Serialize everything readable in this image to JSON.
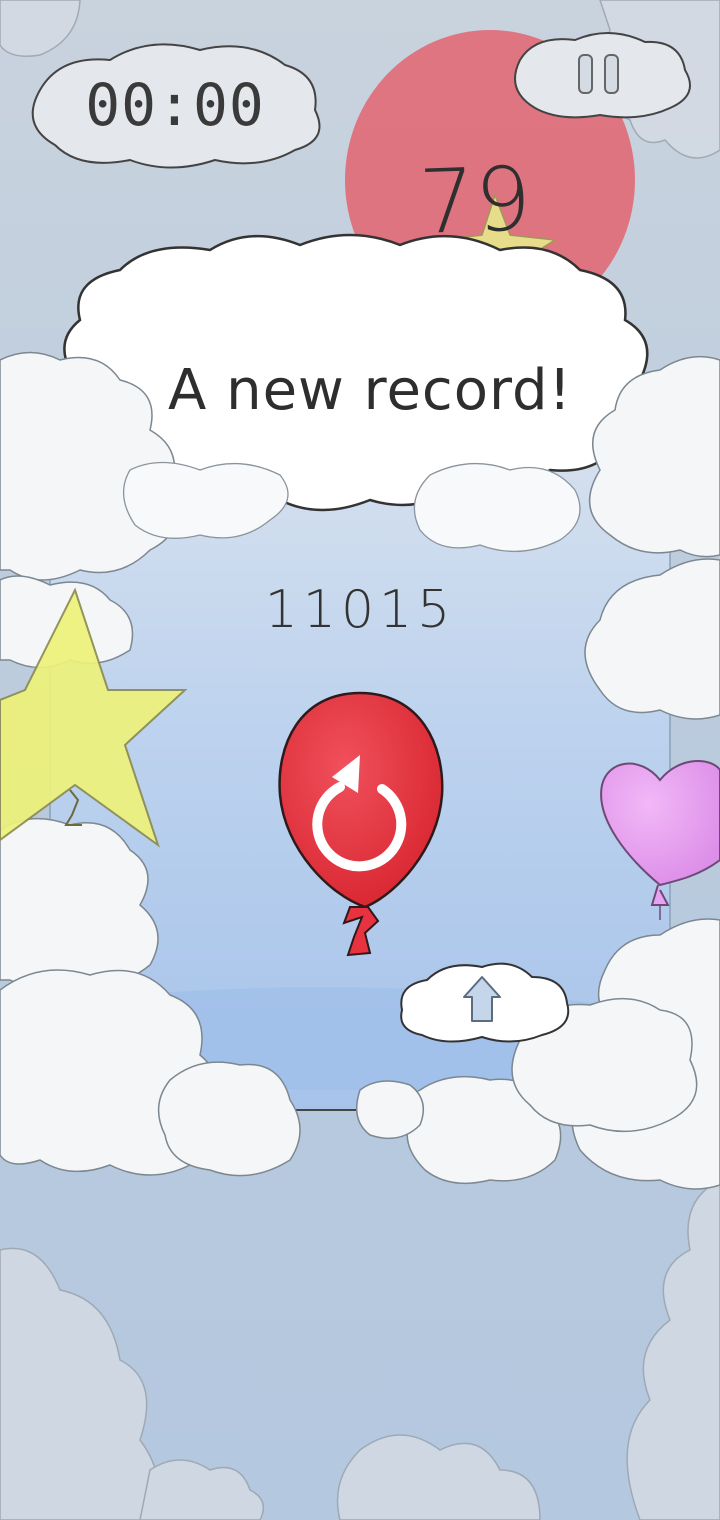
{
  "hud": {
    "timer": "00:00",
    "balloon_count": "79",
    "pause_icon": "pause-icon"
  },
  "game_over": {
    "message": "A new record!",
    "score": "11015",
    "restart_icon": "restart-icon",
    "home_icon": "home-icon"
  },
  "colors": {
    "sky_top": "#c3cfdc",
    "sky_mid": "#a9c6ec",
    "red_balloon": "#e8323f",
    "yellow_star": "#eef27a",
    "pink_heart": "#e8a2f2"
  }
}
